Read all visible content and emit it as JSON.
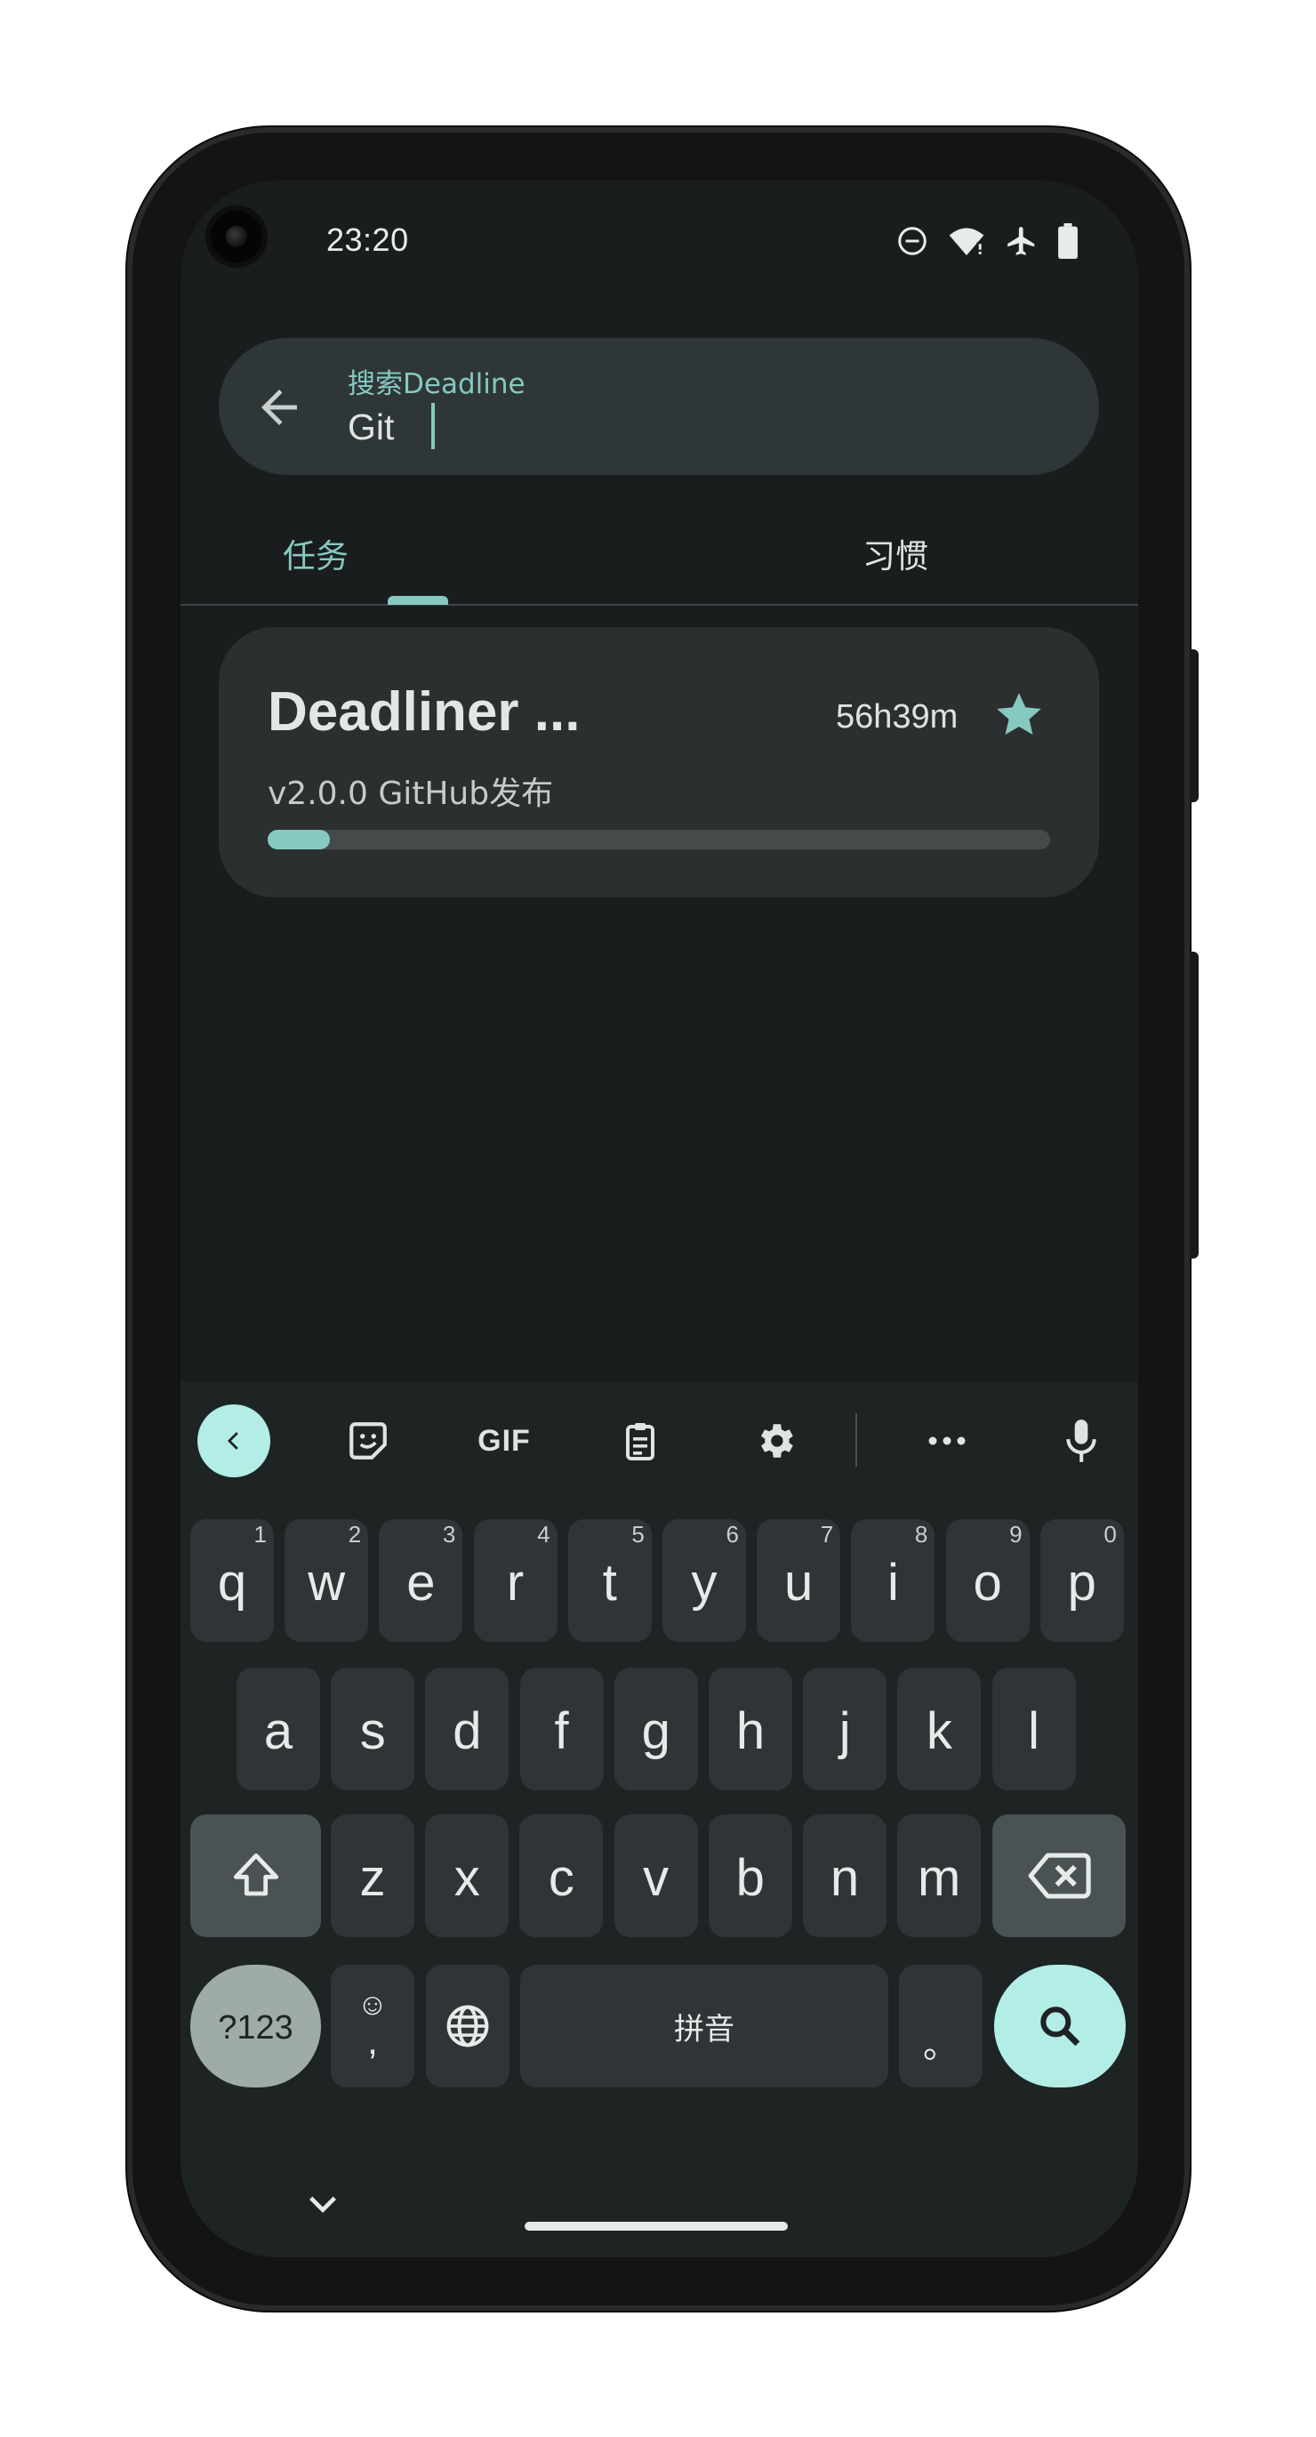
{
  "status_bar": {
    "time": "23:20",
    "icons": [
      "do-not-disturb-icon",
      "wifi-icon",
      "airplane-icon",
      "battery-icon"
    ]
  },
  "search": {
    "label": "搜索Deadline",
    "value": "Git"
  },
  "tabs": [
    {
      "label": "任务",
      "selected": true
    },
    {
      "label": "习惯",
      "selected": false
    }
  ],
  "task": {
    "title": "Deadliner ...",
    "remaining": "56h39m",
    "subtitle": "v2.0.0 GitHub发布",
    "starred": true,
    "progress": 0.08
  },
  "keyboard": {
    "toolbar_icons": [
      "collapse-chevron-icon",
      "sticker-icon",
      "gif-icon",
      "clipboard-icon",
      "settings-gear-icon",
      "more-icon",
      "microphone-icon"
    ],
    "gif_label": "GIF",
    "row1": [
      {
        "key": "q",
        "hint": "1"
      },
      {
        "key": "w",
        "hint": "2"
      },
      {
        "key": "e",
        "hint": "3"
      },
      {
        "key": "r",
        "hint": "4"
      },
      {
        "key": "t",
        "hint": "5"
      },
      {
        "key": "y",
        "hint": "6"
      },
      {
        "key": "u",
        "hint": "7"
      },
      {
        "key": "i",
        "hint": "8"
      },
      {
        "key": "o",
        "hint": "9"
      },
      {
        "key": "p",
        "hint": "0"
      }
    ],
    "row2": [
      "a",
      "s",
      "d",
      "f",
      "g",
      "h",
      "j",
      "k",
      "l"
    ],
    "row3": [
      "z",
      "x",
      "c",
      "v",
      "b",
      "n",
      "m"
    ],
    "symbols_label": "?123",
    "comma": ",",
    "emoji_face": "☺",
    "space_label": "拼音",
    "period": "。"
  },
  "colors": {
    "accent": "#86c9c0",
    "accent_light": "#b2ede6",
    "background": "#191d1e",
    "card": "#2b2f30"
  }
}
